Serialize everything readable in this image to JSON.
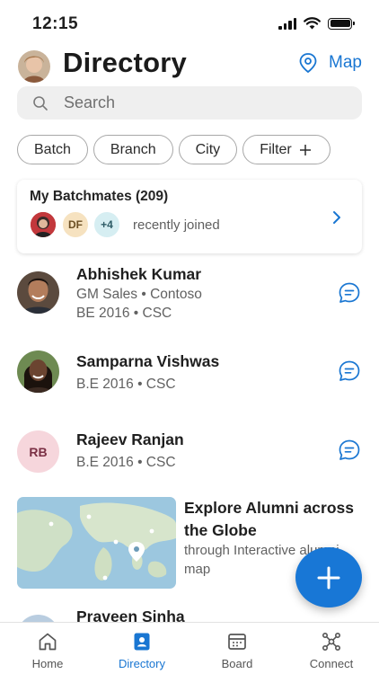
{
  "status_bar": {
    "time": "12:15"
  },
  "header": {
    "title": "Directory",
    "map_label": "Map"
  },
  "search": {
    "placeholder": "Search"
  },
  "filters": {
    "batch": "Batch",
    "branch": "Branch",
    "city": "City",
    "filter": "Filter"
  },
  "batchmates": {
    "title": "My Batchmates (209)",
    "avatar_initials": "DF",
    "more_count": "+4",
    "subtitle": "recently joined"
  },
  "people": [
    {
      "name": "Abhishek Kumar",
      "line1": "GM Sales • Contoso",
      "line2": "BE 2016 • CSC"
    },
    {
      "name": "Samparna Vishwas",
      "line1": "B.E 2016 • CSC"
    },
    {
      "name": "Rajeev Ranjan",
      "initials": "RB",
      "line1": "B.E 2016 • CSC"
    },
    {
      "name": "Praveen Sinha"
    }
  ],
  "explore": {
    "title": "Explore Alumni across the Globe",
    "subtitle": "through Interactive alumni map"
  },
  "nav": {
    "home": "Home",
    "directory": "Directory",
    "board": "Board",
    "connect": "Connect"
  },
  "colors": {
    "accent": "#1976d2",
    "fab": "#1877d6"
  }
}
